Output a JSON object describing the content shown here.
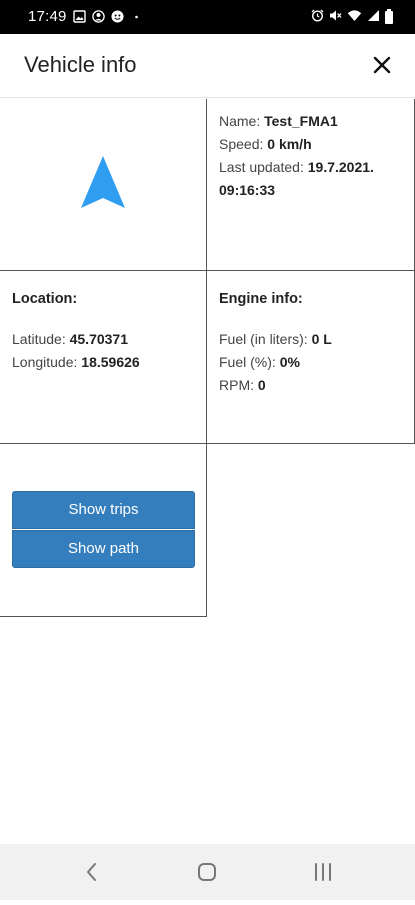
{
  "status_bar": {
    "time": "17:49",
    "left_icons": [
      "image-icon",
      "account-icon",
      "face-icon",
      "dot-icon"
    ],
    "right_icons": [
      "alarm-icon",
      "mute-icon",
      "wifi-icon",
      "signal-icon",
      "battery-icon"
    ]
  },
  "modal": {
    "title": "Vehicle info"
  },
  "vehicle": {
    "name_label": "Name: ",
    "name": "Test_FMA1",
    "speed_label": "Speed: ",
    "speed": "0 km/h",
    "last_updated_label": "Last updated: ",
    "last_updated_date": "19.7.2021.",
    "last_updated_time": "09:16:33",
    "heading_icon": "navigation-arrow-icon",
    "accent_color": "#2f9ef0"
  },
  "location": {
    "heading": "Location:",
    "latitude_label": "Latitude: ",
    "latitude": "45.70371",
    "longitude_label": "Longitude: ",
    "longitude": "18.59626"
  },
  "engine": {
    "heading": "Engine info:",
    "fuel_liters_label": "Fuel (in liters): ",
    "fuel_liters": "0 L",
    "fuel_percent_label": "Fuel (%): ",
    "fuel_percent": "0%",
    "rpm_label": "RPM: ",
    "rpm": "0"
  },
  "actions": {
    "show_trips": "Show trips",
    "show_path": "Show path",
    "button_color": "#357ebd"
  }
}
